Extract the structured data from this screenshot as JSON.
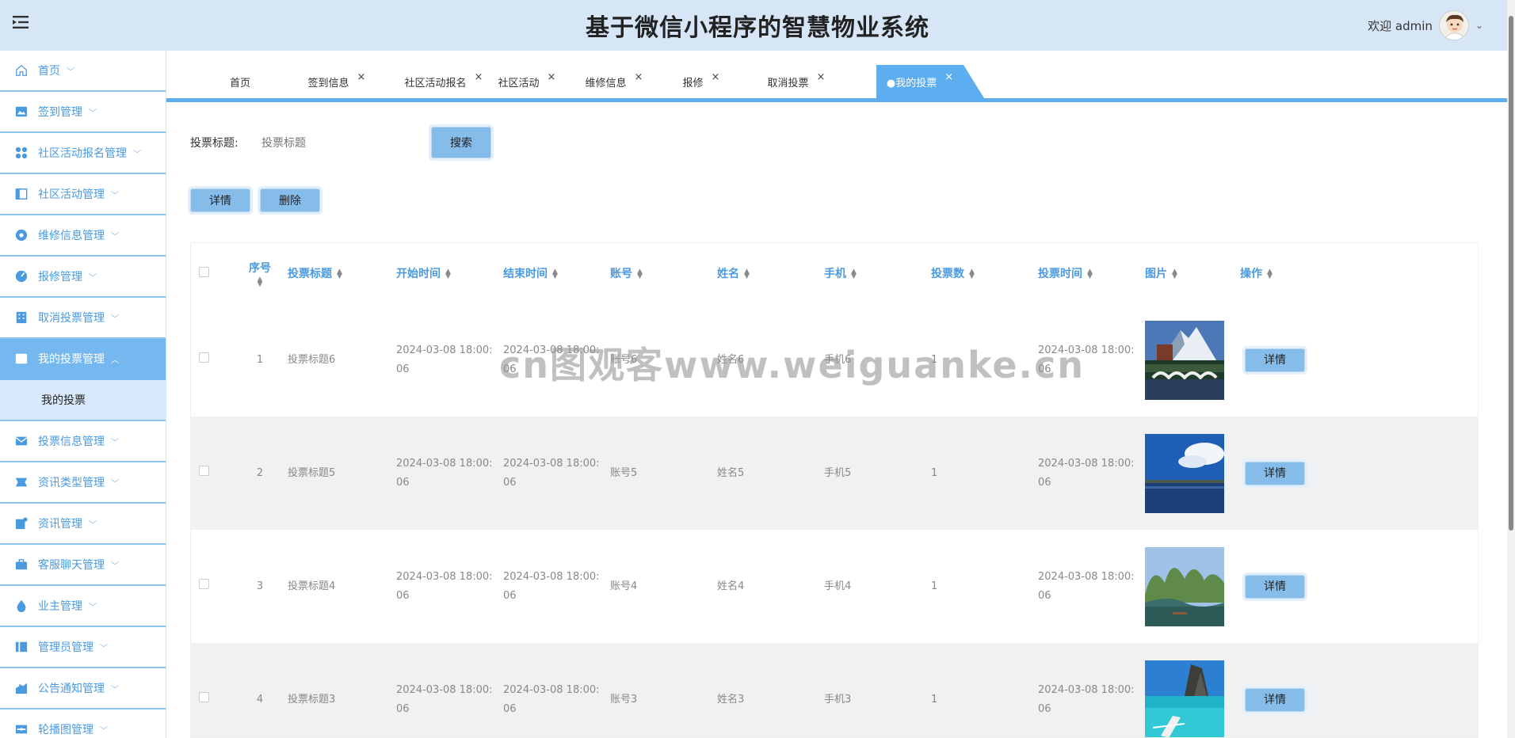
{
  "header": {
    "title": "基于微信小程序的智慧物业系统",
    "welcome": "欢迎 admin"
  },
  "sidebar": {
    "items": [
      {
        "label": "首页",
        "icon": "home-icon"
      },
      {
        "label": "签到管理",
        "icon": "image-icon"
      },
      {
        "label": "社区活动报名管理",
        "icon": "grid-icon"
      },
      {
        "label": "社区活动管理",
        "icon": "panel-icon"
      },
      {
        "label": "维修信息管理",
        "icon": "circle-icon"
      },
      {
        "label": "报修管理",
        "icon": "gauge-icon"
      },
      {
        "label": "取消投票管理",
        "icon": "building-icon"
      },
      {
        "label": "我的投票管理",
        "icon": "image-icon",
        "active": true
      },
      {
        "label": "投票信息管理",
        "icon": "mail-icon"
      },
      {
        "label": "资讯类型管理",
        "icon": "flag-icon"
      },
      {
        "label": "资讯管理",
        "icon": "doc-icon"
      },
      {
        "label": "客服聊天管理",
        "icon": "briefcase-icon"
      },
      {
        "label": "业主管理",
        "icon": "drop-icon"
      },
      {
        "label": "管理员管理",
        "icon": "columns-icon"
      },
      {
        "label": "公告通知管理",
        "icon": "chart-icon"
      },
      {
        "label": "轮播图管理",
        "icon": "slider-icon"
      }
    ],
    "sub_item": "我的投票"
  },
  "tabs": [
    {
      "label": "首页",
      "closable": false
    },
    {
      "label": "签到信息",
      "closable": true
    },
    {
      "label": "社区活动报名",
      "closable": true
    },
    {
      "label": "社区活动",
      "closable": true
    },
    {
      "label": "维修信息",
      "closable": true
    },
    {
      "label": "报修",
      "closable": true
    },
    {
      "label": "取消投票",
      "closable": true
    },
    {
      "label": "●我的投票",
      "closable": true,
      "active": true
    }
  ],
  "search": {
    "label": "投票标题:",
    "placeholder": "投票标题",
    "button": "搜索"
  },
  "actions": {
    "detail": "详情",
    "delete": "删除"
  },
  "table": {
    "columns": [
      "序号",
      "投票标题",
      "开始时间",
      "结束时间",
      "账号",
      "姓名",
      "手机",
      "投票数",
      "投票时间",
      "图片",
      "操作"
    ],
    "rows": [
      {
        "no": "1",
        "title": "投票标题6",
        "start": "2024-03-08 18:00:06",
        "end": "2024-03-08 18:00:06",
        "account": "账号6",
        "name": "姓名6",
        "phone": "手机6",
        "votes": "1",
        "vote_time": "2024-03-08 18:00:06",
        "image": "mountain-bridge-photo",
        "op": "详情"
      },
      {
        "no": "2",
        "title": "投票标题5",
        "start": "2024-03-08 18:00:06",
        "end": "2024-03-08 18:00:06",
        "account": "账号5",
        "name": "姓名5",
        "phone": "手机5",
        "votes": "1",
        "vote_time": "2024-03-08 18:00:06",
        "image": "lake-sky-photo",
        "op": "详情"
      },
      {
        "no": "3",
        "title": "投票标题4",
        "start": "2024-03-08 18:00:06",
        "end": "2024-03-08 18:00:06",
        "account": "账号4",
        "name": "姓名4",
        "phone": "手机4",
        "votes": "1",
        "vote_time": "2024-03-08 18:00:06",
        "image": "karst-river-photo",
        "op": "详情"
      },
      {
        "no": "4",
        "title": "投票标题3",
        "start": "2024-03-08 18:00:06",
        "end": "2024-03-08 18:00:06",
        "account": "账号3",
        "name": "姓名3",
        "phone": "手机3",
        "votes": "1",
        "vote_time": "2024-03-08 18:00:06",
        "image": "sea-boat-photo",
        "op": "详情"
      }
    ]
  },
  "watermark": "cn图观客www.weiguanke.cn",
  "colors": {
    "header_bg": "#d6e6f7",
    "accent": "#5caef0",
    "sidebar_text": "#4a9ae0",
    "button_bg": "#86bce9",
    "row_alt": "#eff1f3"
  }
}
